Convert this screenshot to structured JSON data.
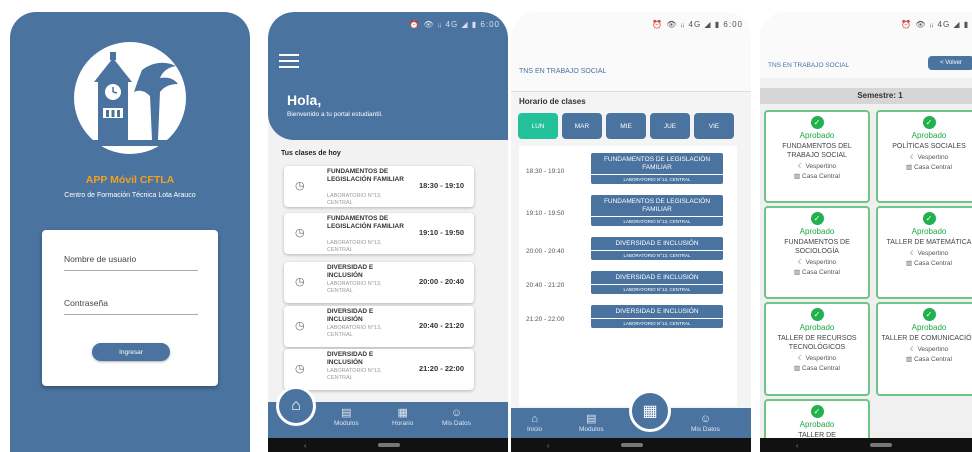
{
  "colors": {
    "primary": "#4a73a0",
    "accent_orange": "#f4a020",
    "active_day": "#22c19a",
    "approved_green": "#22a845"
  },
  "status_bar": {
    "text": "⏰ 👁 ᵢᵢ 4G ◢ ▮ 6:00"
  },
  "login": {
    "app_title": "APP Móvil CFTLA",
    "subtitle": "Centro de Formación Técnica Lota Arauco",
    "username_placeholder": "Nombre de usuario",
    "password_placeholder": "Contraseña",
    "submit_label": "Ingresar"
  },
  "home": {
    "greeting": "Hola,",
    "welcome": "Bienvenido a tu portal estudiantil.",
    "section_title": "Tus clases de hoy",
    "classes": [
      {
        "name": "FUNDAMENTOS DE LEGISLACIÓN FAMILIAR",
        "room": "LABORATORIO N°13, CENTRAL",
        "time": "18:30 - 19:10"
      },
      {
        "name": "FUNDAMENTOS DE LEGISLACIÓN FAMILIAR",
        "room": "LABORATORIO N°13, CENTRAL",
        "time": "19:10 - 19:50"
      },
      {
        "name": "DIVERSIDAD E INCLUSIÓN",
        "room": "LABORATORIO N°13, CENTRAL",
        "time": "20:00 - 20:40"
      },
      {
        "name": "DIVERSIDAD E INCLUSIÓN",
        "room": "LABORATORIO N°13, CENTRAL",
        "time": "20:40 - 21:20"
      },
      {
        "name": "DIVERSIDAD E INCLUSIÓN",
        "room": "LABORATORIO N°13, CENTRAL",
        "time": "21:20 - 22:00"
      }
    ],
    "tabs": {
      "modulos": "Modulos",
      "horario": "Horario",
      "mis_datos": "Mis Datos"
    }
  },
  "schedule": {
    "program": "TNS EN TRABAJO SOCIAL",
    "section_title": "Horario de clases",
    "days": [
      "LUN",
      "MAR",
      "MIE",
      "JUE",
      "VIE"
    ],
    "blocks": [
      {
        "time": "18:30 - 19:10",
        "name": "FUNDAMENTOS DE LEGISLACIÓN FAMILIAR",
        "room": "LABORATORIO N°13, CENTRAL"
      },
      {
        "time": "19:10 - 19:50",
        "name": "FUNDAMENTOS DE LEGISLACIÓN FAMILIAR",
        "room": "LABORATORIO N°13, CENTRAL"
      },
      {
        "time": "20:00 - 20:40",
        "name": "DIVERSIDAD E INCLUSIÓN",
        "room": "LABORATORIO N°13, CENTRAL"
      },
      {
        "time": "20:40 - 21:20",
        "name": "DIVERSIDAD E INCLUSIÓN",
        "room": "LABORATORIO N°13, CENTRAL"
      },
      {
        "time": "21:20 - 22:00",
        "name": "DIVERSIDAD E INCLUSIÓN",
        "room": "LABORATORIO N°13, CENTRAL"
      }
    ],
    "tabs": {
      "inicio": "Inicio",
      "modulos": "Modulos",
      "mis_datos": "Mis Datos"
    }
  },
  "modules": {
    "program": "TNS EN TRABAJO SOCIAL",
    "back_label": "< Volver",
    "semester": "Semestre: 1",
    "subjects": [
      {
        "status": "Aprobado",
        "name": "FUNDAMENTOS DEL TRABAJO SOCIAL",
        "shift": "Vespertino",
        "campus": "Casa Central"
      },
      {
        "status": "Aprobado",
        "name": "POLÍTICAS SOCIALES",
        "shift": "Vespertino",
        "campus": "Casa Central"
      },
      {
        "status": "Aprobado",
        "name": "FUNDAMENTOS DE SOCIOLOGÍA",
        "shift": "Vespertino",
        "campus": "Casa Central"
      },
      {
        "status": "Aprobado",
        "name": "TALLER DE MATEMÁTICA",
        "shift": "Vespertino",
        "campus": "Casa Central"
      },
      {
        "status": "Aprobado",
        "name": "TALLER DE RECURSOS TECNOLÓGICOS",
        "shift": "Vespertino",
        "campus": "Casa Central"
      },
      {
        "status": "Aprobado",
        "name": "TALLER DE COMUNICACIÓN",
        "shift": "Vespertino",
        "campus": "Casa Central"
      },
      {
        "status": "Aprobado",
        "name": "TALLER DE",
        "shift": "",
        "campus": ""
      }
    ]
  }
}
